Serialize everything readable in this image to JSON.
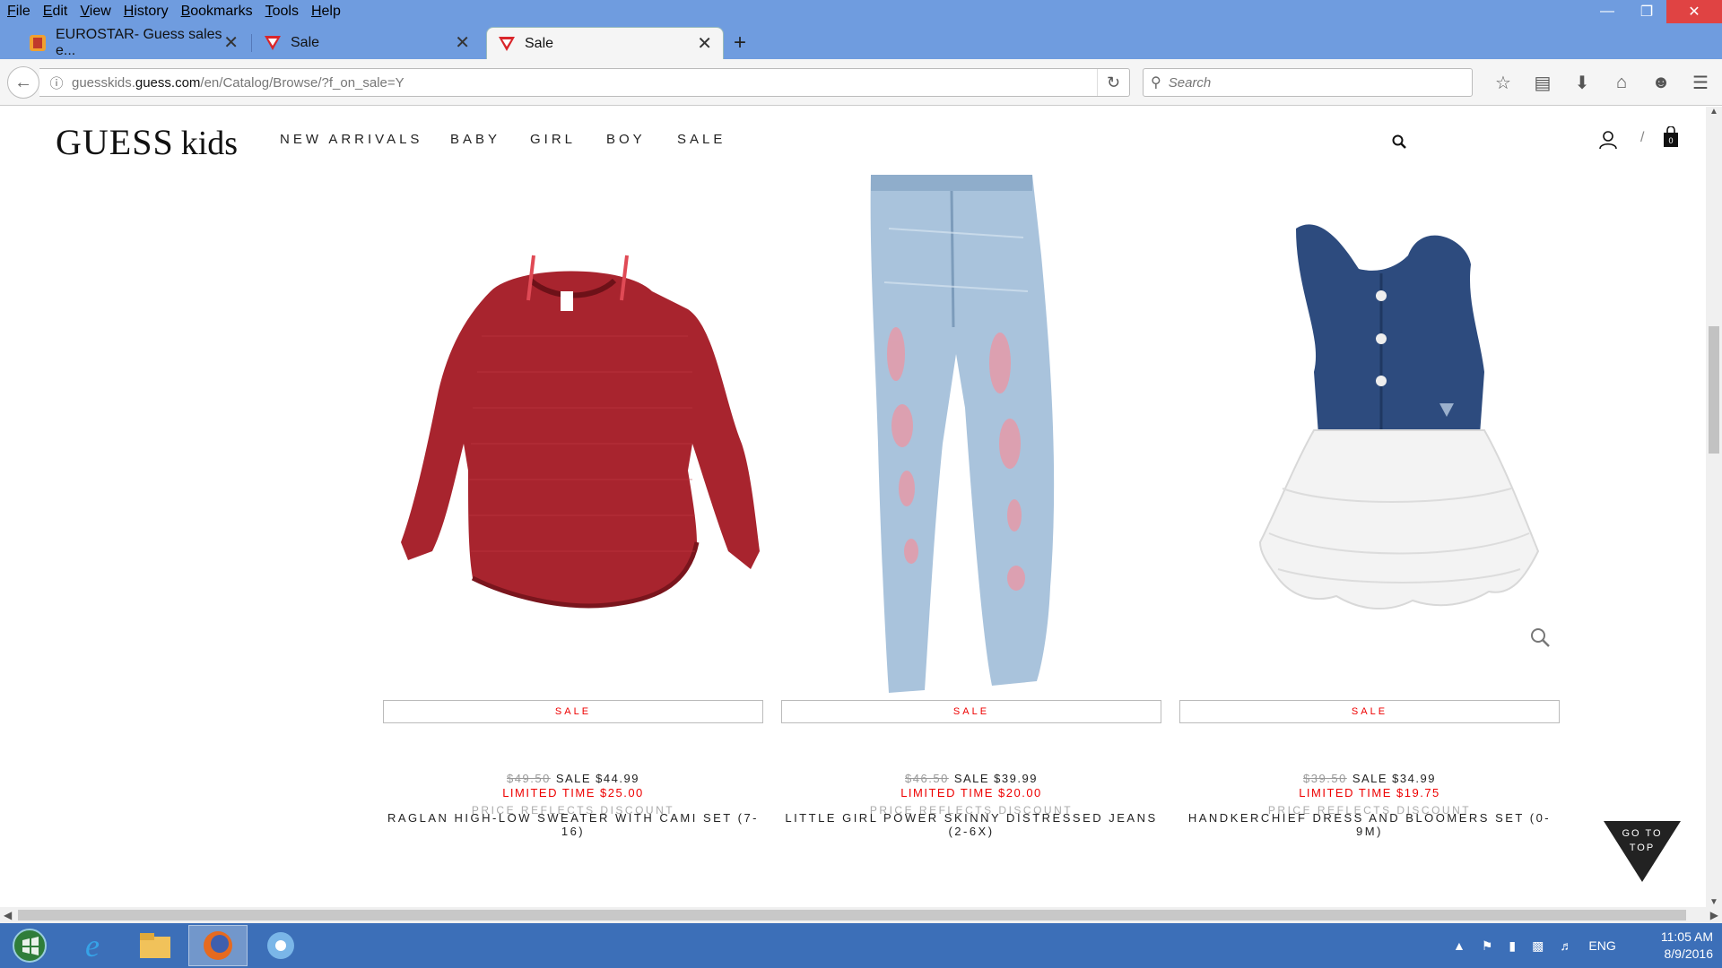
{
  "menu": [
    "File",
    "Edit",
    "View",
    "History",
    "Bookmarks",
    "Tools",
    "Help"
  ],
  "tabs": [
    {
      "label": "EUROSTAR- Guess sales e...",
      "icon": "eurostar-icon",
      "active": false
    },
    {
      "label": "Sale",
      "icon": "guess-triangle-icon",
      "active": false
    },
    {
      "label": "Sale",
      "icon": "guess-triangle-icon",
      "active": true
    }
  ],
  "url": {
    "prefix": "guesskids.",
    "domain": "guess.com",
    "path": "/en/Catalog/Browse/?f_on_sale=Y"
  },
  "search": {
    "placeholder": "Search"
  },
  "site": {
    "logo_main": "GUESS",
    "logo_sub": "kids",
    "nav": [
      "NEW ARRIVALS",
      "BABY",
      "GIRL",
      "BOY",
      "SALE"
    ],
    "cart_count": "0"
  },
  "products": [
    {
      "name": "RAGLAN HIGH-LOW SWEATER WITH CAMI SET (7-16)",
      "badge": "SALE",
      "orig_price": "$49.50",
      "sale_price": "SALE $44.99",
      "limited": "LIMITED TIME $25.00",
      "discount_note": "PRICE REFLECTS DISCOUNT",
      "color": "#a8242e"
    },
    {
      "name": "LITTLE GIRL POWER SKINNY DISTRESSED JEANS (2-6X)",
      "badge": "SALE",
      "orig_price": "$46.50",
      "sale_price": "SALE $39.99",
      "limited": "LIMITED TIME $20.00",
      "discount_note": "PRICE REFLECTS DISCOUNT",
      "color": "#a9c3dc"
    },
    {
      "name": "HANDKERCHIEF DRESS AND BLOOMERS SET (0-9M)",
      "badge": "SALE",
      "orig_price": "$39.50",
      "sale_price": "SALE $34.99",
      "limited": "LIMITED TIME $19.75",
      "discount_note": "PRICE REFLECTS DISCOUNT",
      "color": "#2d4b7e"
    }
  ],
  "goto_top": {
    "line1": "GO TO",
    "line2": "TOP"
  },
  "taskbar": {
    "lang": "ENG",
    "time": "11:05 AM",
    "date": "8/9/2016"
  }
}
